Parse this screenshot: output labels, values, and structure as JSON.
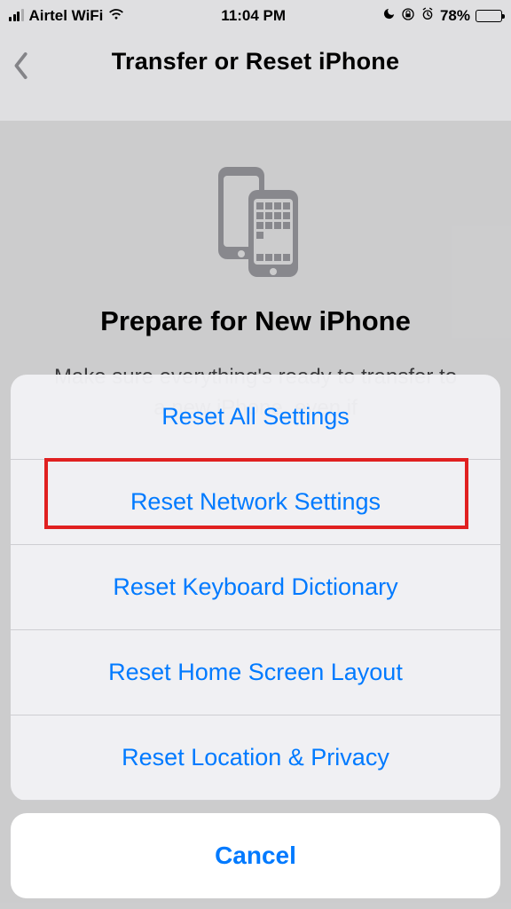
{
  "status": {
    "carrier": "Airtel WiFi",
    "time": "11:04 PM",
    "battery_pct": "78%"
  },
  "nav": {
    "title": "Transfer or Reset iPhone"
  },
  "content": {
    "title": "Prepare for New iPhone",
    "subtitle": "Make sure everything's ready to transfer to a new iPhone, even if"
  },
  "sheet": {
    "items": [
      "Reset All Settings",
      "Reset Network Settings",
      "Reset Keyboard Dictionary",
      "Reset Home Screen Layout",
      "Reset Location & Privacy"
    ],
    "cancel": "Cancel"
  }
}
